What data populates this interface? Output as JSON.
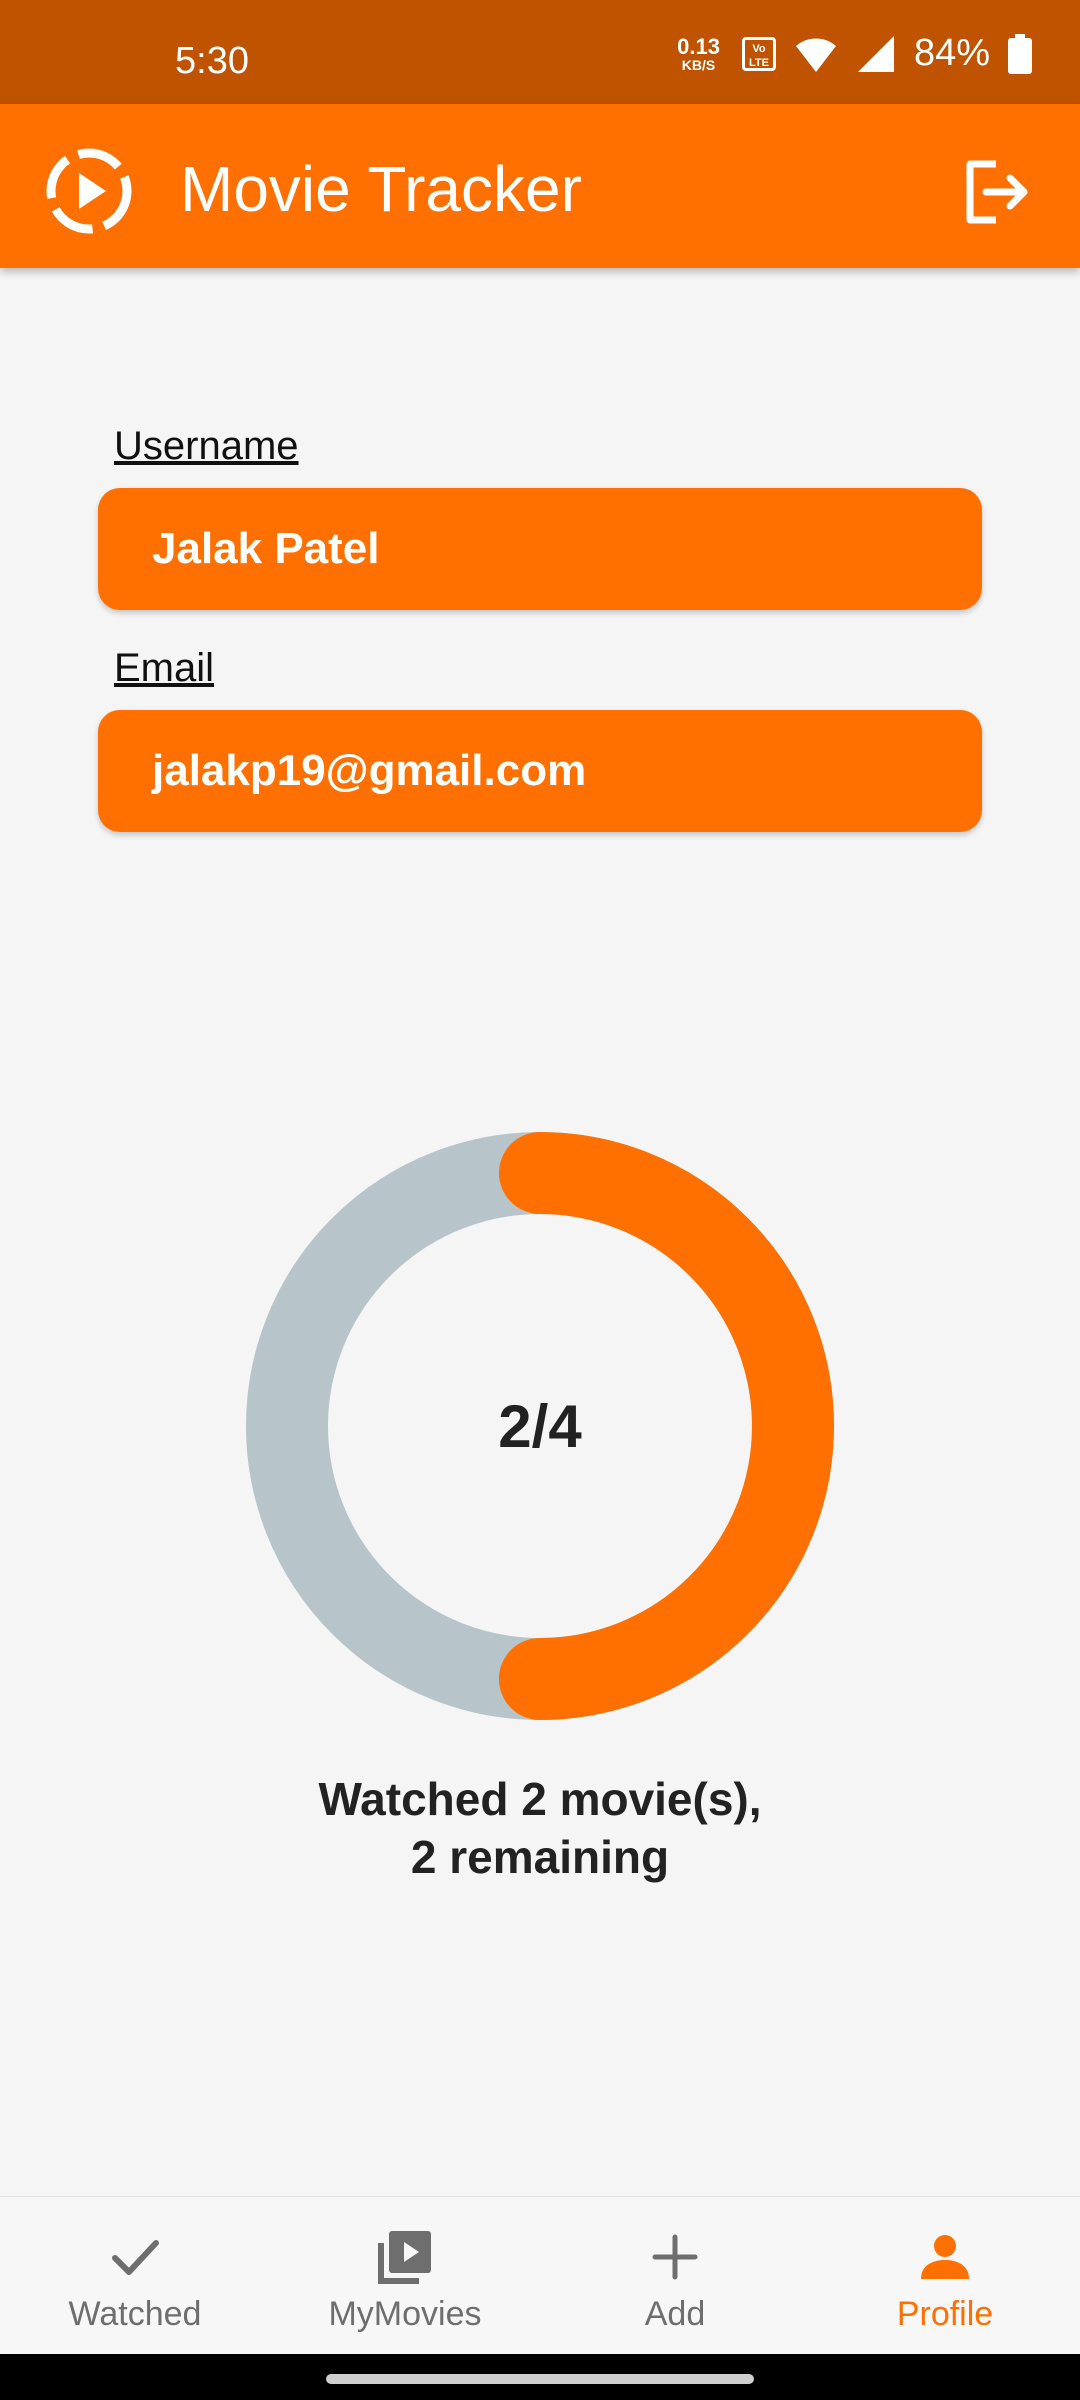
{
  "status_bar": {
    "time": "5:30",
    "net_speed_value": "0.13",
    "net_speed_unit": "KB/S",
    "volte_label": "Vo LTE",
    "battery_pct": "84%"
  },
  "app_bar": {
    "title": "Movie Tracker",
    "logo_icon": "play-circle-dashed-icon",
    "logout_icon": "logout-icon"
  },
  "profile": {
    "username_label": "Username",
    "username_value": "Jalak Patel",
    "email_label": "Email",
    "email_value": "jalakp19@gmail.com"
  },
  "progress": {
    "watched": 2,
    "total": 4,
    "center_text": "2/4",
    "summary_line1": "Watched 2 movie(s),",
    "summary_line2": "2 remaining",
    "accent_color": "#FF7000",
    "track_color": "#B7C5CA"
  },
  "bottom_nav": {
    "items": [
      {
        "label": "Watched",
        "icon": "check-icon",
        "active": false
      },
      {
        "label": "MyMovies",
        "icon": "video-library-icon",
        "active": false
      },
      {
        "label": "Add",
        "icon": "plus-icon",
        "active": false
      },
      {
        "label": "Profile",
        "icon": "person-icon",
        "active": true
      }
    ]
  },
  "colors": {
    "primary": "#FF7000",
    "primary_dark": "#BF5300",
    "background": "#F5F5F5",
    "inactive": "#6E6E6E"
  }
}
